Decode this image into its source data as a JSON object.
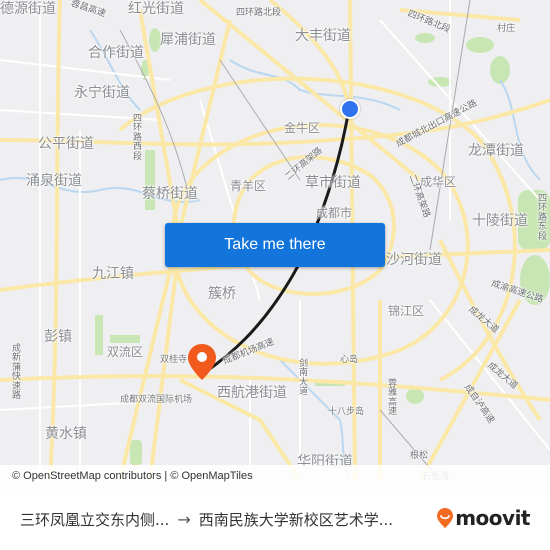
{
  "map": {
    "colors": {
      "background": "#efeff1",
      "road": "#fbe8a6",
      "minor_road": "#ffffff",
      "park": "#c8e6b4",
      "water": "#b9d7f0",
      "route_line": "#1a1a1a",
      "origin_marker": "#2f73f0",
      "destination_marker": "#f25a1d"
    },
    "labels": {
      "deyuan": "德源街道",
      "pixian_gaosu": "蓉昌高速",
      "hongguang": "红光街道",
      "sihuan_beiduan": "四环路北段",
      "xipu": "犀浦街道",
      "dafeng": "大丰街道",
      "cunzhuang": "村庄",
      "hezuo": "合作街道",
      "yongning": "永宁街道",
      "jinniu": "金牛区",
      "chengdu_beichukou": "成都城北出口高速公路",
      "sihuan_xiduan": "四环路西段",
      "gongping": "公平街道",
      "longtan": "龙潭街道",
      "erhuan_gaojia": "二环高架路",
      "yongquan": "涌泉街道",
      "caiqiao": "蔡桥街道",
      "qingyang": "青羊区",
      "caoshi": "草市街道",
      "chenghua": "成华区",
      "chengdu_shi": "成都市",
      "erhuan_gaojia2": "二环高架路",
      "shiling": "十陵街道",
      "sihuan2": "四环路东段",
      "jiujiang": "九江镇",
      "shahe": "沙河街道",
      "chengyu_gaosu": "成渝高速公路",
      "cuqiao": "簇桥",
      "jinjiang": "锦江区",
      "pengzhen": "彭镇",
      "shuangliu": "双流区",
      "shuanggui": "双桂寺",
      "jichang_gaosu": "成都机场高速",
      "xinxin": "心岛",
      "chengxin_kuaisu": "成新蒲快速路",
      "jiannan": "剑南大道",
      "chengdu_airport": "成都双流国际机场",
      "xihanggang": "西航港街道",
      "shibabu": "十八步岛",
      "chenglong": "成龙大道",
      "rongya": "蓉雅高速",
      "chengzi": "成自泸高速",
      "huangshui": "黄水镇",
      "gensong": "根松",
      "huayang": "华阳街道",
      "shibantan": "石板滩"
    },
    "cta_label": "Take me there",
    "attribution": "© OpenStreetMap contributors | © OpenMapTiles"
  },
  "footer": {
    "origin": "三环凤凰立交东内侧...",
    "arrow": "→",
    "destination": "西南民族大学新校区艺术学...",
    "brand": "moovit"
  }
}
